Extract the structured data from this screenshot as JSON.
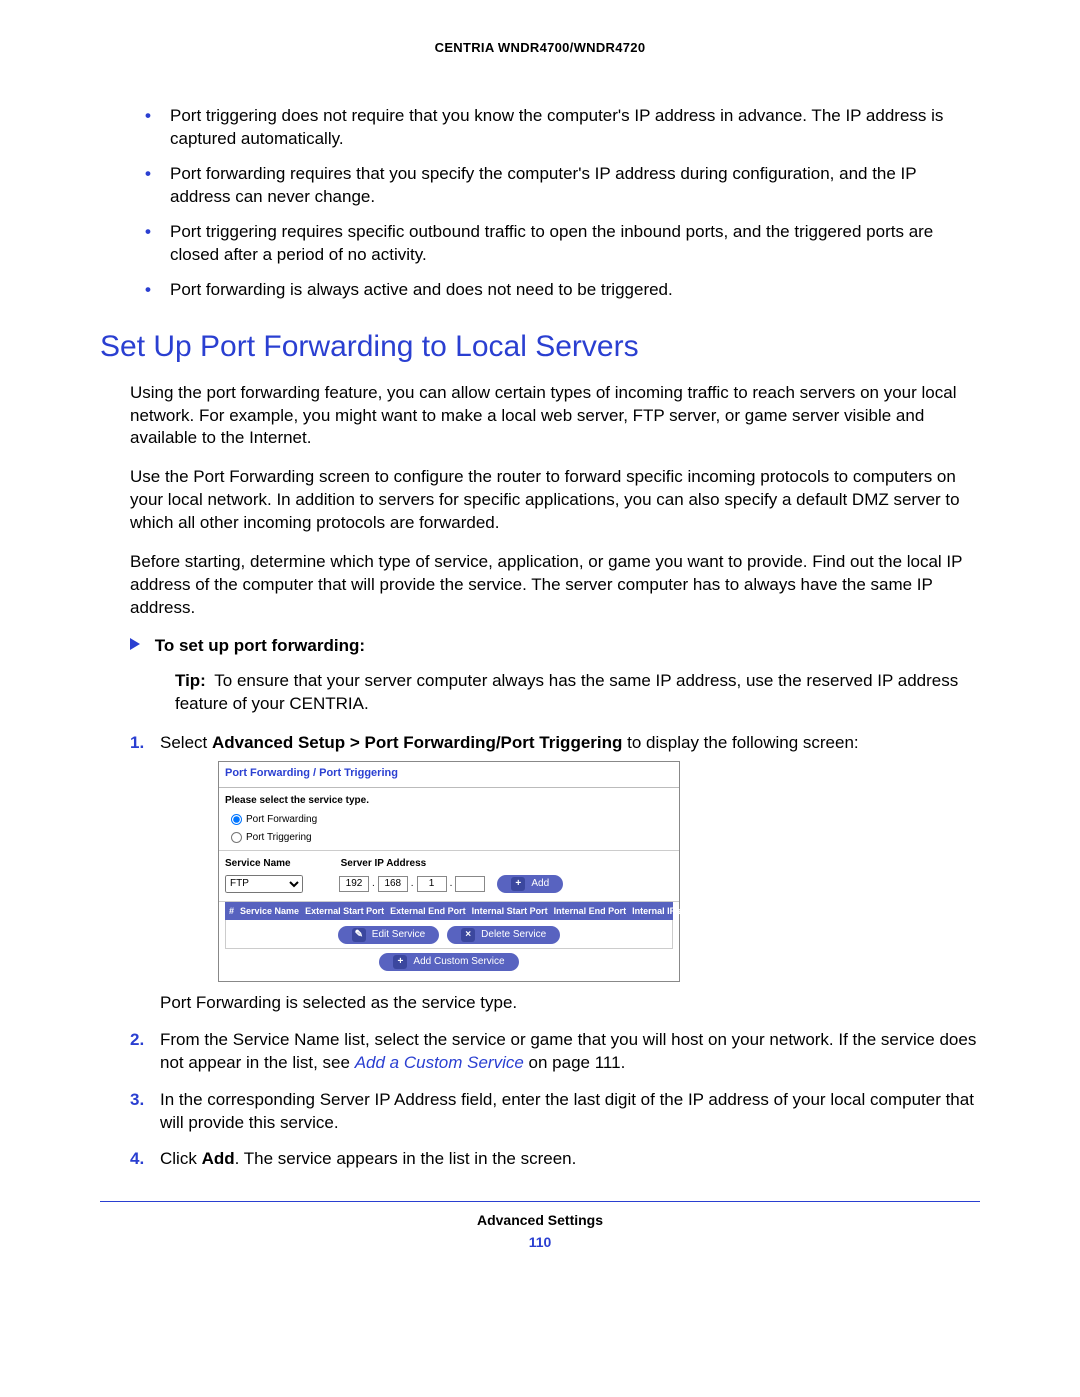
{
  "header": {
    "product": "CENTRIA WNDR4700/WNDR4720"
  },
  "bullets": [
    "Port triggering does not require that you know the computer's IP address in advance. The IP address is captured automatically.",
    "Port forwarding requires that you specify the computer's IP address during configuration, and the IP address can never change.",
    "Port triggering requires specific outbound traffic to open the inbound ports, and the triggered ports are closed after a period of no activity.",
    "Port forwarding is always active and does not need to be triggered."
  ],
  "section": {
    "title": "Set Up Port Forwarding to Local Servers"
  },
  "paras": {
    "p1": "Using the port forwarding feature, you can allow certain types of incoming traffic to reach servers on your local network. For example, you might want to make a local web server, FTP server, or game server visible and available to the Internet.",
    "p2": "Use the Port Forwarding screen to configure the router to forward specific incoming protocols to computers on your local network. In addition to servers for specific applications, you can also specify a default DMZ server to which all other incoming protocols are forwarded.",
    "p3": "Before starting, determine which type of service, application, or game you want to provide. Find out the local IP address of the computer that will provide the service. The server computer has to always have the same IP address."
  },
  "procedure": {
    "title": "To set up port forwarding:"
  },
  "tip": {
    "label": "Tip:",
    "text": "To ensure that your server computer always has the same IP address, use the reserved IP address feature of your CENTRIA."
  },
  "steps": {
    "s1a": "Select ",
    "s1b": "Advanced Setup > Port Forwarding/Port Triggering",
    "s1c": " to display the following screen:",
    "s1_after": "Port Forwarding is selected as the service type.",
    "s2a": "From the Service Name list, select the service or game that you will host on your network. If the service does not appear in the list, see ",
    "s2_link": "Add a Custom Service",
    "s2b": " on page 111.",
    "s3": "In the corresponding Server IP Address field, enter the last digit of the IP address of your local computer that will provide this service.",
    "s4a": "Click ",
    "s4b": "Add",
    "s4c": ". The service appears in the list in the screen."
  },
  "router": {
    "title": "Port Forwarding / Port Triggering",
    "select_type": "Please select the service type.",
    "opt_fwd": "Port Forwarding",
    "opt_trg": "Port Triggering",
    "col_service": "Service Name",
    "col_ip": "Server IP Address",
    "service_value": "FTP",
    "ip": {
      "o1": "192",
      "o2": "168",
      "o3": "1",
      "o4": ""
    },
    "btn_add": "Add",
    "btn_edit": "Edit Service",
    "btn_delete": "Delete Service",
    "btn_custom": "Add Custom Service",
    "thead": {
      "c0": "#",
      "c1": "Service Name",
      "c2": "External Start Port",
      "c3": "External End Port",
      "c4": "Internal Start Port",
      "c5": "Internal End Port",
      "c6": "Internal IP address"
    }
  },
  "footer": {
    "section": "Advanced Settings",
    "page": "110"
  }
}
